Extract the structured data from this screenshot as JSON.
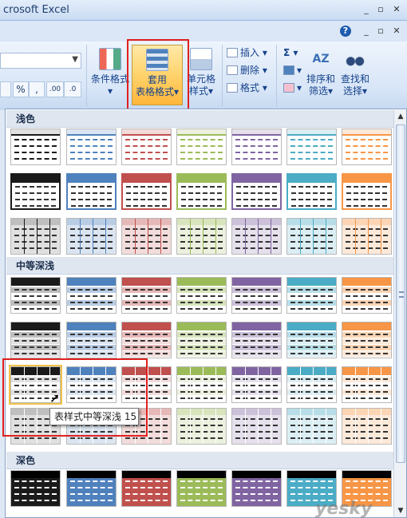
{
  "window": {
    "title": "crosoft Excel",
    "min": "_",
    "restore": "▫",
    "close": "✕"
  },
  "ribbonbar": {
    "help": "?",
    "min": "_",
    "restore": "▫",
    "close": "✕"
  },
  "ribbon": {
    "format_buttons": [
      "%",
      ",",
      ".00",
      ".0"
    ],
    "number_arrow": "▼",
    "cond_format": {
      "line1": "条件格式",
      "line2": "▾"
    },
    "table_style": {
      "line1": "套用",
      "line2": "表格格式▾"
    },
    "cell_style": {
      "line1": "单元格",
      "line2": "样式▾"
    },
    "cells": {
      "insert": "插入 ▾",
      "delete": "删除 ▾",
      "format": "格式 ▾"
    },
    "editing": {
      "sum": "Σ ▾",
      "fill": "▾",
      "clear": "▾"
    },
    "sort": {
      "line1": "排序和",
      "line2": "筛选▾"
    },
    "find": {
      "line1": "查找和",
      "line2": "选择▾"
    }
  },
  "gallery": {
    "sections": {
      "light": "浅色",
      "medium": "中等深浅",
      "dark": "深色"
    },
    "colors": [
      "#1a1a1a",
      "#4f81bd",
      "#c0504d",
      "#9bbb59",
      "#8064a2",
      "#4bacc6",
      "#f79646"
    ],
    "tints": [
      "#e0e0e0",
      "#dbe5f1",
      "#f2dcdb",
      "#ebf1de",
      "#e5e0ec",
      "#dbeef3",
      "#fde9d9"
    ],
    "bands": [
      "#bfbfbf",
      "#b8cce4",
      "#e6b9b8",
      "#d7e4bc",
      "#ccc1da",
      "#b7dee8",
      "#fcd5b4"
    ]
  },
  "tooltip": {
    "text": "表样式中等深浅 15"
  },
  "scrollbar": {
    "up": "▲",
    "down": "▼"
  },
  "watermark": "yesky"
}
